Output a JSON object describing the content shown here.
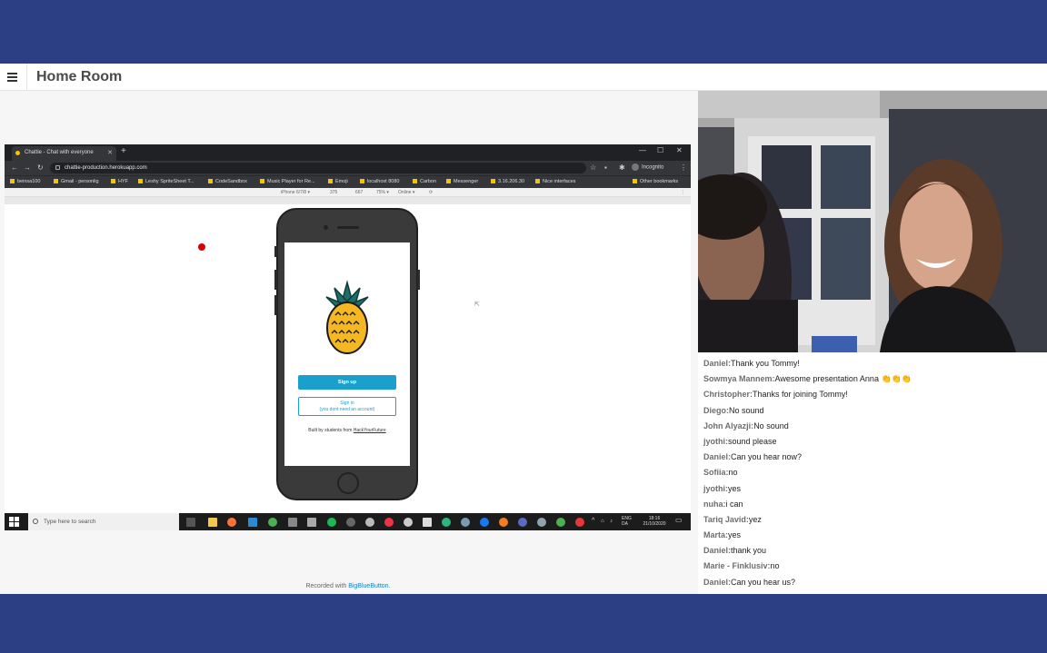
{
  "header": {
    "room_title": "Home Room"
  },
  "browser": {
    "tab_title": "Chattie - Chat with everyone",
    "url": "chattie-production.herokuapp.com",
    "profile": "Incognito",
    "bookmarks": [
      "beinsa100",
      "Gmail - personlig",
      "HYF",
      "Leshy SpriteSheet T...",
      "CodeSandbox",
      "Music Player for Re...",
      "Emoji",
      "localhost 8080",
      "Carbon",
      "Messenger",
      "3.16.206.30",
      "Nice interfaces"
    ],
    "other_bookmarks": "Other bookmarks",
    "devtools": {
      "device": "iPhone 6/7/8 ▾",
      "width": "375",
      "height": "667",
      "zoom": "75% ▾",
      "network": "Online ▾"
    }
  },
  "phone_app": {
    "signup_label": "Sign up",
    "signin_label": "Sign in",
    "signin_sub": "(you dont need an account)",
    "built_prefix": "Built by students from ",
    "built_link": "HackYourFuture"
  },
  "taskbar": {
    "search_placeholder": "Type here to search",
    "lang1": "ENG",
    "lang2": "DA",
    "time": "18:16",
    "date": "21/10/2020"
  },
  "recorded": {
    "prefix": "Recorded with ",
    "brand": "BigBlueButton."
  },
  "chat": {
    "messages": [
      {
        "author": "Daniel:",
        "text": "Thank you Tommy!"
      },
      {
        "author": "Sowmya Mannem:",
        "text": "Awesome presentation Anna ",
        "emoji": "👏👏👏"
      },
      {
        "author": "Christopher:",
        "text": "Thanks for joining Tommy!"
      },
      {
        "author": "Diego:",
        "text": "No sound"
      },
      {
        "author": "John Alyazji:",
        "text": "No sound"
      },
      {
        "author": "jyothi:",
        "text": "sound please"
      },
      {
        "author": "Daniel:",
        "text": "Can you hear now?"
      },
      {
        "author": "Sofiia:",
        "text": "no"
      },
      {
        "author": "jyothi:",
        "text": "yes"
      },
      {
        "author": "nuha:",
        "text": "i can"
      },
      {
        "author": "Tariq Javid:",
        "text": "yez"
      },
      {
        "author": "Marta:",
        "text": "yes"
      },
      {
        "author": "Daniel:",
        "text": "thank you"
      },
      {
        "author": "Marie - Finklusiv:",
        "text": "no"
      },
      {
        "author": "Daniel:",
        "text": "Can you hear us?"
      }
    ]
  }
}
